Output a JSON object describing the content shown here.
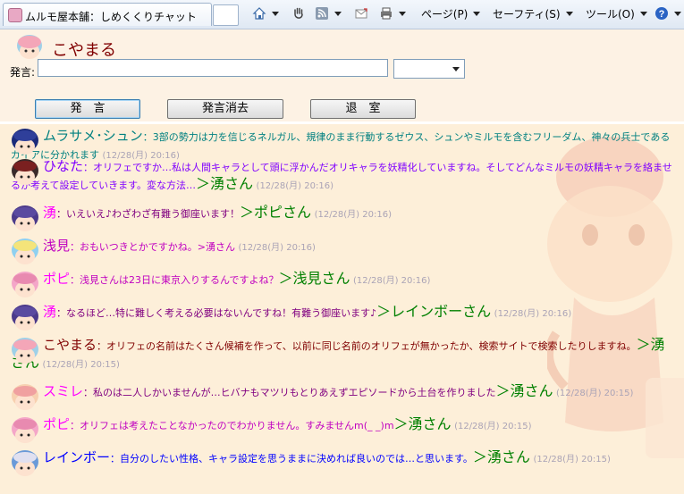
{
  "browser": {
    "tab_title": "ムルモ屋本舗：しめくくりチャット",
    "menus": {
      "page": "ページ(P)",
      "safety": "セーフティ(S)",
      "tools": "ツール(O)"
    }
  },
  "header": {
    "username": "こやまる",
    "say_label": "発言:",
    "input_value": "",
    "buttons": {
      "say": "発　言",
      "clear": "発言消去",
      "leave": "退　室"
    }
  },
  "messages": [
    {
      "name": "ムラサメ･シュン",
      "name_color": "#008080",
      "text_color": "#008080",
      "text": "：3部の勢力は力を信じるネルガル、規律のまま行動するゼウス、シュンやミルモを含むフリーダム、神々の兵士であるガイアに分かれます",
      "to": "",
      "time": "(12/28(月) 20:16)",
      "avatar": "murasame"
    },
    {
      "name": "ひなた",
      "name_color": "#8000ff",
      "text_color": "#8000ff",
      "text": "：オリフェですか…私は人間キャラとして頭に浮かんだオリキャラを妖精化していますね。そしてどんなミルモの妖精キャラを絡ませるか考えて設定していきます。変な方法…",
      "to": "＞湧さん",
      "time": "(12/28(月) 20:16)",
      "avatar": "hinata"
    },
    {
      "name": "湧",
      "name_color": "#ff00ff",
      "text_color": "#800080",
      "text": "：いえいえ♪わざわざ有難う御座います！",
      "to": "＞ポピさん",
      "time": "(12/28(月) 20:16)",
      "avatar": "waku"
    },
    {
      "name": "浅見",
      "name_color": "#c000c0",
      "text_color": "#c000c0",
      "text": "：おもいつきとかですかね。>湧さん",
      "to": "",
      "time": "(12/28(月) 20:16)",
      "avatar": "asami"
    },
    {
      "name": "ポピ",
      "name_color": "#ff00ff",
      "text_color": "#c000c0",
      "text": "：浅見さんは23日に東京入りするんですよね？",
      "to": "＞浅見さん",
      "time": "(12/28(月) 20:16)",
      "avatar": "popi"
    },
    {
      "name": "湧",
      "name_color": "#ff00ff",
      "text_color": "#800080",
      "text": "：なるほど…特に難しく考える必要はないんですね！有難う御座います♪",
      "to": "＞レインボーさん",
      "time": "(12/28(月) 20:16)",
      "avatar": "waku"
    },
    {
      "name": "こやまる",
      "name_color": "#800000",
      "text_color": "#800000",
      "text": "：オリフェの名前はたくさん候補を作って、以前に同じ名前のオリフェが無かったか、検索サイトで検索したりしますね。",
      "to": "＞湧さん",
      "time": "(12/28(月) 20:15)",
      "avatar": "koyamaru"
    },
    {
      "name": "スミレ",
      "name_color": "#ff00ff",
      "text_color": "#800080",
      "text": "：私のは二人しかいませんが…ヒバナもマツリもとりあえずエピソードから土台を作りました",
      "to": "＞湧さん",
      "time": "(12/28(月) 20:15)",
      "avatar": "sumire"
    },
    {
      "name": "ポピ",
      "name_color": "#ff00ff",
      "text_color": "#c000c0",
      "text": "：オリフェは考えたことなかったのでわかりません。すみませんm(_ _)m",
      "to": "＞湧さん",
      "time": "(12/28(月) 20:15)",
      "avatar": "popi"
    },
    {
      "name": "レインボー",
      "name_color": "#0000ff",
      "text_color": "#0000ff",
      "text": "：自分のしたい性格、キャラ設定を思うままに決めれば良いのでは…と思います。",
      "to": "＞湧さん",
      "time": "(12/28(月) 20:15)",
      "avatar": "rainbow"
    }
  ],
  "colors": {
    "background": "#fdf2e4",
    "log_background": "#fdefd9",
    "to_color": "#008000",
    "time_color": "#aaa3b6"
  }
}
